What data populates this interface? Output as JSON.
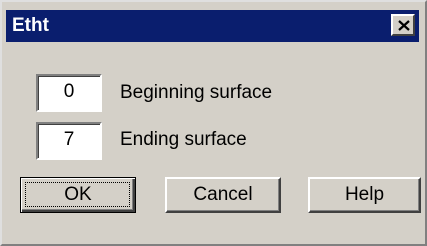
{
  "window": {
    "title": "Etht",
    "close_icon": "close-icon"
  },
  "fields": {
    "beginning": {
      "value": "0",
      "label": "Beginning surface"
    },
    "ending": {
      "value": "7",
      "label": "Ending surface"
    }
  },
  "buttons": {
    "ok": "OK",
    "cancel": "Cancel",
    "help": "Help"
  },
  "colors": {
    "titlebar": "#0a1e6e",
    "face": "#d4d0c8"
  }
}
